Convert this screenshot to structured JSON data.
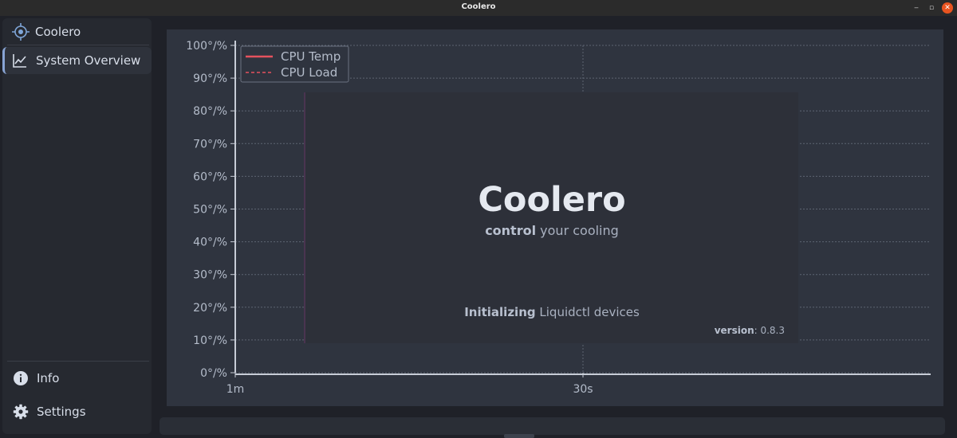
{
  "window": {
    "title": "Coolero",
    "minimize_glyph": "‒",
    "maximize_glyph": "▫",
    "close_glyph": "✕"
  },
  "sidebar": {
    "brand": {
      "label": "Coolero",
      "icon": "coolero-logo-icon"
    },
    "items": [
      {
        "label": "System Overview",
        "icon": "line-chart-icon",
        "active": true
      }
    ],
    "footer_items": [
      {
        "label": "Info",
        "icon": "info-icon"
      },
      {
        "label": "Settings",
        "icon": "gear-icon"
      }
    ]
  },
  "chart_data": {
    "type": "line",
    "title": "",
    "xlabel": "",
    "ylabel": "",
    "ylim": [
      0,
      100
    ],
    "y_ticks": [
      "0°/%",
      "10°/%",
      "20°/%",
      "30°/%",
      "40°/%",
      "50°/%",
      "60°/%",
      "70°/%",
      "80°/%",
      "90°/%",
      "100°/%"
    ],
    "x_ticks": [
      "1m",
      "30s"
    ],
    "grid": true,
    "legend_position": "top-left",
    "series": [
      {
        "name": "CPU Temp",
        "style": "solid",
        "color": "#e5525e",
        "values": []
      },
      {
        "name": "CPU Load",
        "style": "dashed",
        "color": "#e5525e",
        "values": []
      }
    ]
  },
  "colors": {
    "background": "#1f2128",
    "panel": "#2f343f",
    "accent": "#88a4d4",
    "series": "#e5525e"
  },
  "splash": {
    "title": "Coolero",
    "subtitle_bold": "control",
    "subtitle_rest": " your cooling",
    "status_bold": "Initializing",
    "status_rest": " Liquidctl devices",
    "version_label": "version",
    "version_value": ": 0.8.3"
  }
}
